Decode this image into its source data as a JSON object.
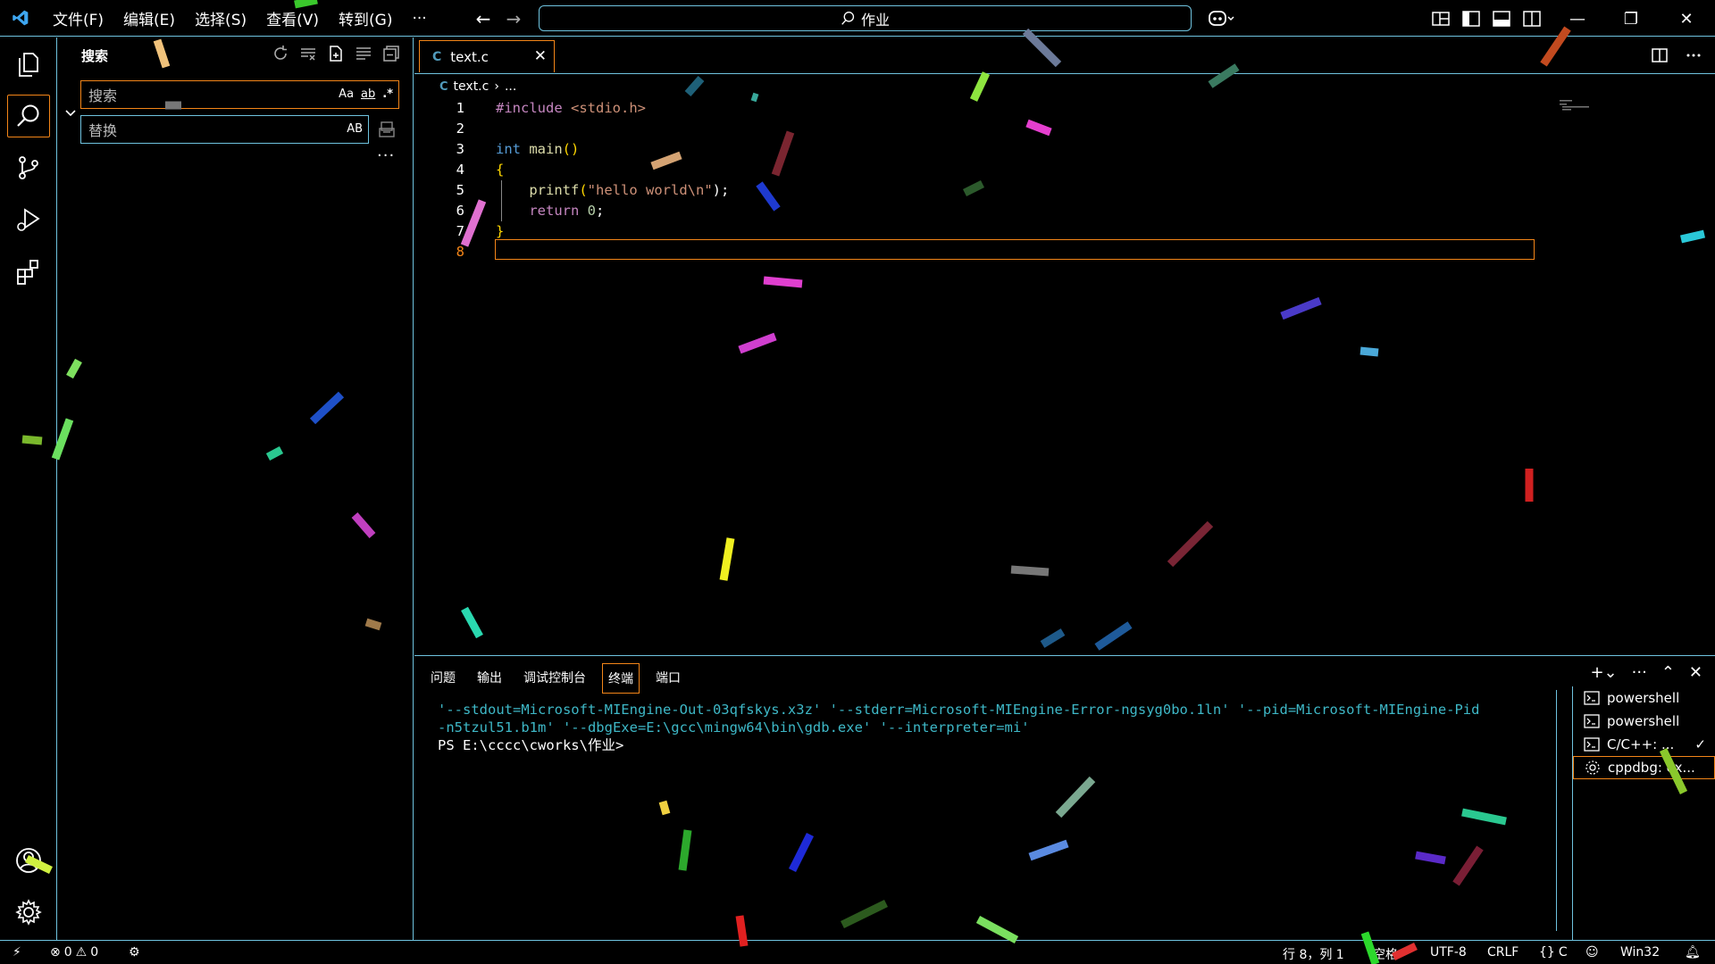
{
  "titlebar": {
    "menu": [
      "文件(F)",
      "编辑(E)",
      "选择(S)",
      "查看(V)",
      "转到(G)",
      "···"
    ],
    "search_text": "作业"
  },
  "sidebar": {
    "title": "搜索",
    "search_placeholder": "搜索",
    "replace_placeholder": "替换",
    "opt_case": "Aa",
    "opt_word": "ab",
    "opt_regex": ".*",
    "opt_preserve": "AB",
    "more": "···"
  },
  "editor": {
    "tab_icon": "C",
    "tab_label": "text.c",
    "breadcrumb_file": "text.c",
    "breadcrumb_rest": "...",
    "line_numbers": [
      "1",
      "2",
      "3",
      "4",
      "5",
      "6",
      "7",
      "8"
    ],
    "code": {
      "l1_pre": "#include",
      "l1_hdr": "<stdio.h>",
      "l3_kw": "int",
      "l3_fn": "main",
      "l3_paren": "()",
      "l4_brace": "{",
      "l5_fn": "printf",
      "l5_open": "(",
      "l5_str": "\"hello world\\n\"",
      "l5_close": ");",
      "l6_kw": "return",
      "l6_num": "0",
      "l6_semi": ";",
      "l7_brace": "}"
    }
  },
  "panel": {
    "tabs": [
      "问题",
      "输出",
      "调试控制台",
      "终端",
      "端口"
    ],
    "active_tab": "终端",
    "terminal_lines": [
      "'--stdout=Microsoft-MIEngine-Out-03qfskys.x3z' '--stderr=Microsoft-MIEngine-Error-ngsyg0bo.1ln' '--pid=Microsoft-MIEngine-Pid",
      "-n5tzul51.b1m' '--dbgExe=E:\\gcc\\mingw64\\bin\\gdb.exe' '--interpreter=mi'",
      "PS E:\\cccc\\cworks\\作业>"
    ],
    "terminals": [
      "powershell",
      "powershell",
      "C/C++: ...",
      "cppdbg: ex..."
    ]
  },
  "statusbar": {
    "errors": "0",
    "warnings": "0",
    "position": "行 8，列 1",
    "indent": "空格",
    "encoding": "UTF-8",
    "eol": "CRLF",
    "language_braces": "{}",
    "language": "C",
    "platform": "Win32"
  },
  "colors": {
    "border": "#6fc3df",
    "focus": "#f38518",
    "background": "#000000"
  }
}
